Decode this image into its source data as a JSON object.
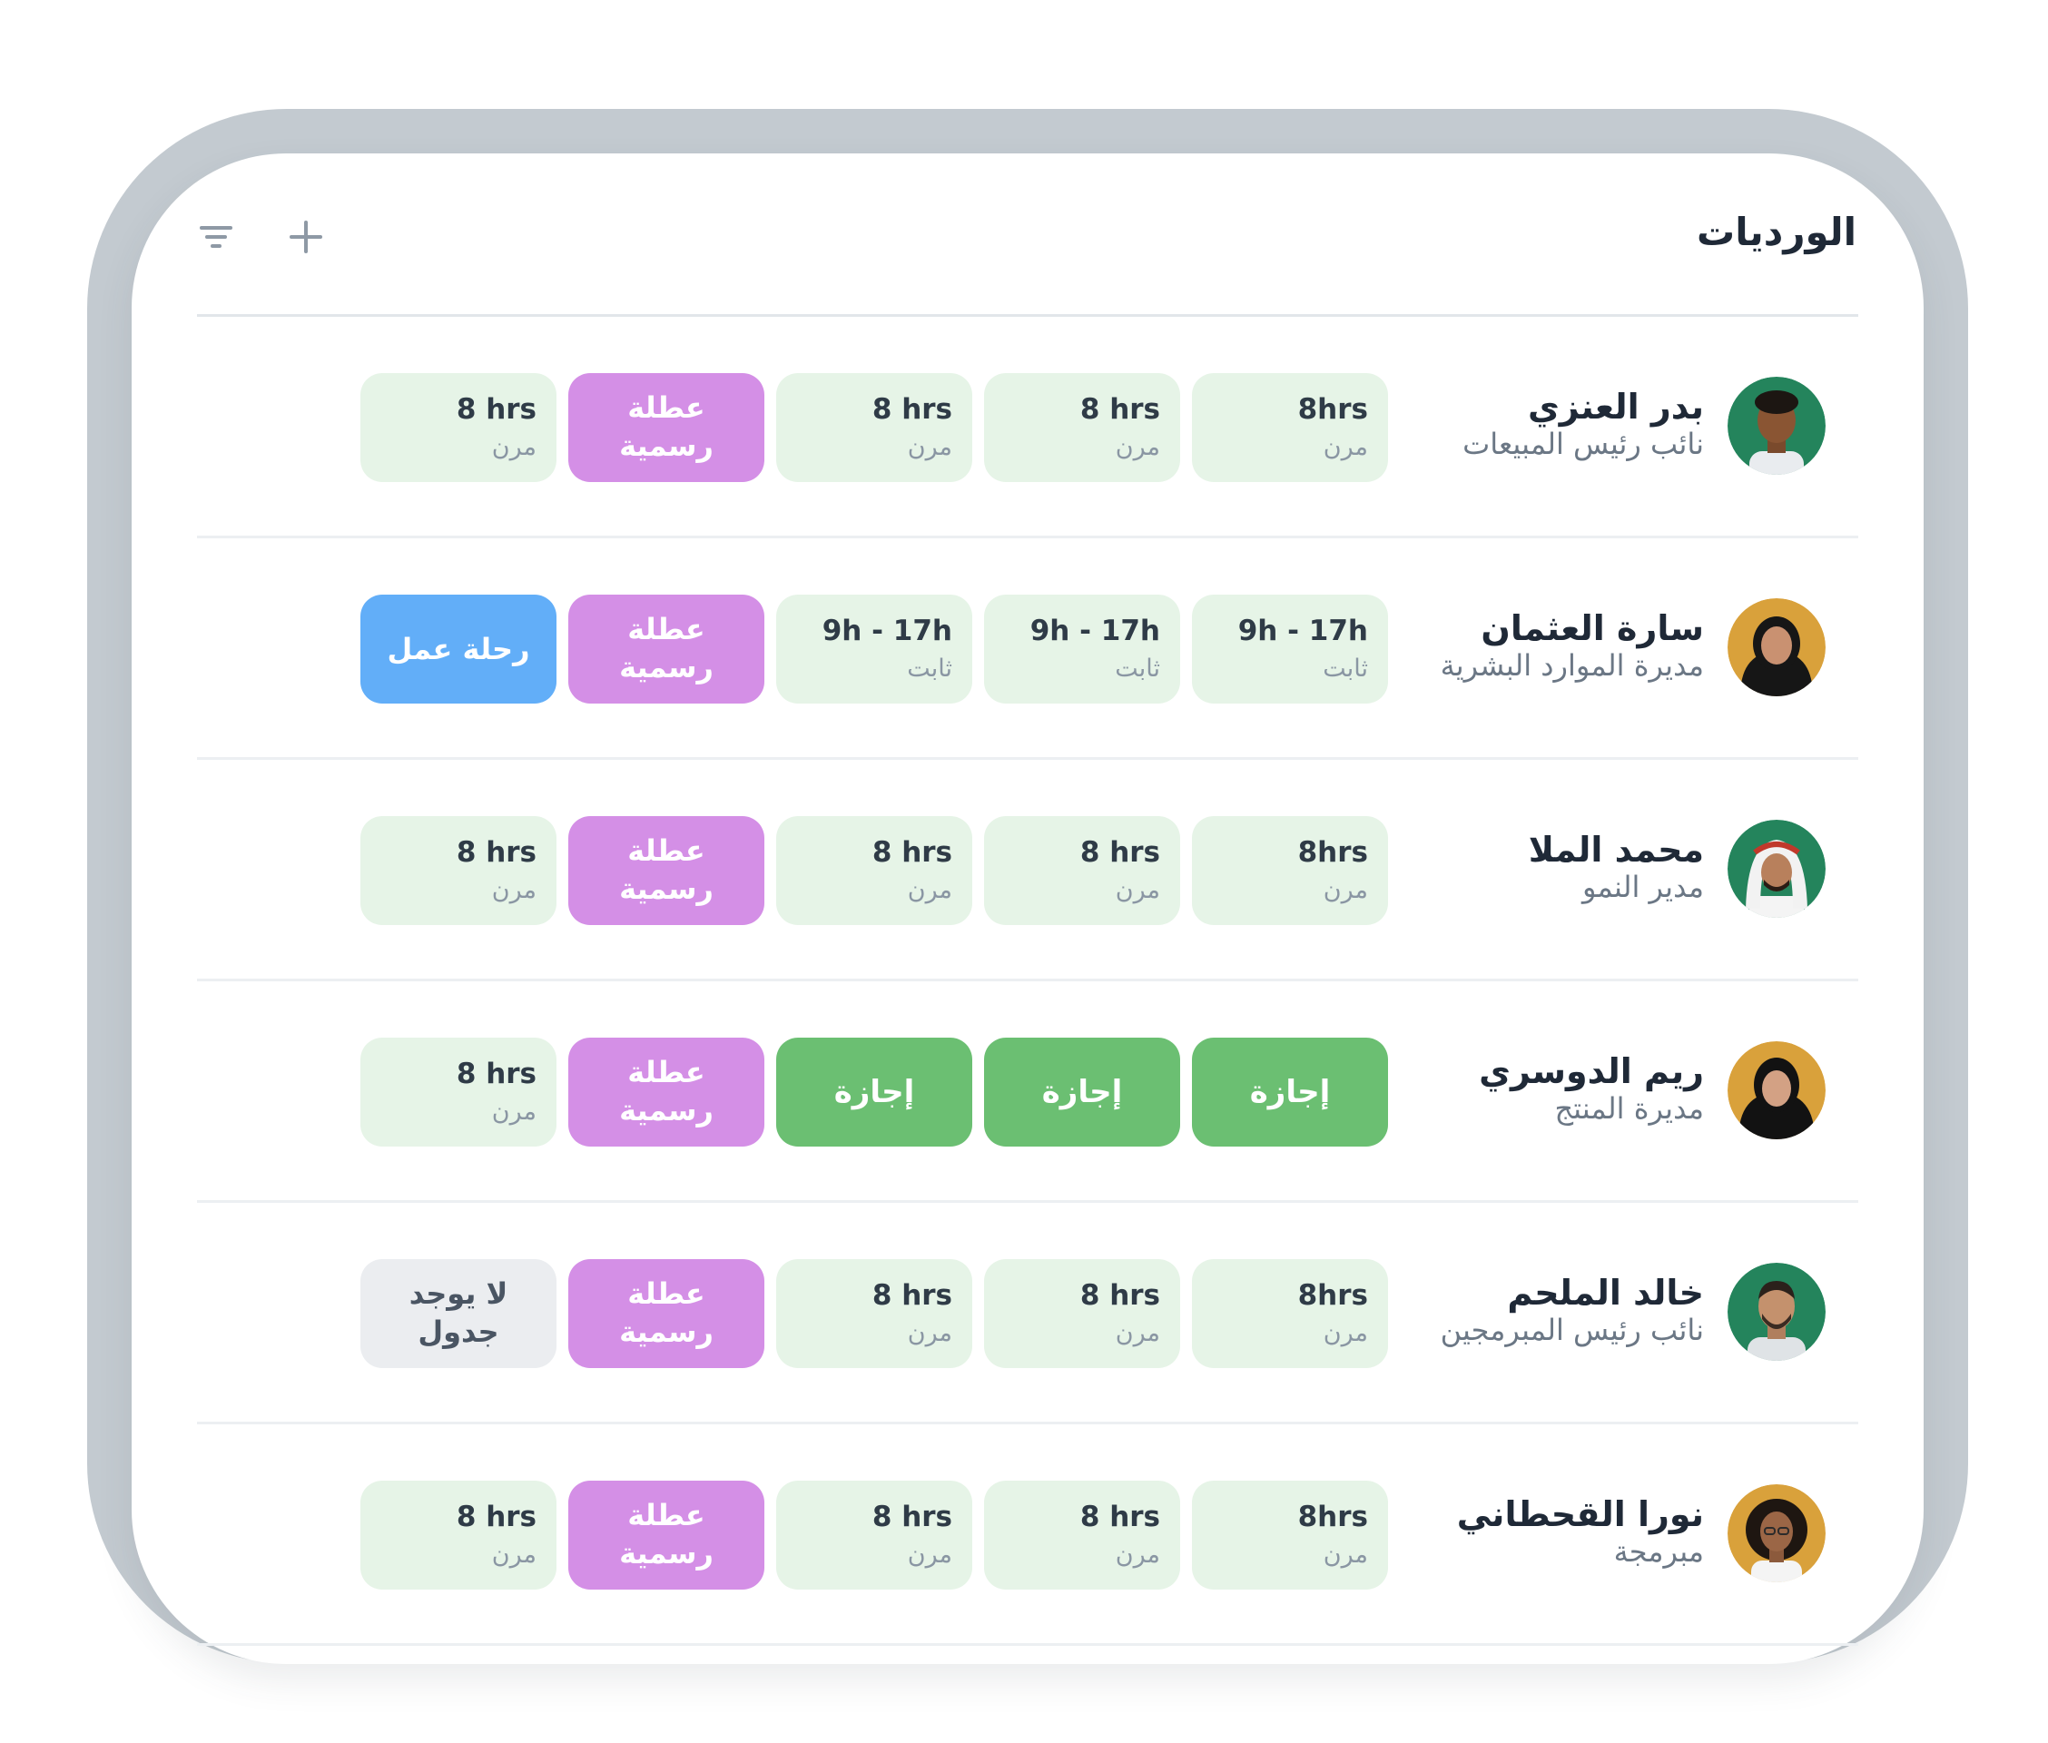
{
  "header": {
    "title": "الورديات",
    "filter_icon": "filter-icon",
    "add_icon": "plus-icon"
  },
  "colors": {
    "light_shift": "#e6f4e7",
    "holiday": "#d48fe6",
    "leave": "#6bbf72",
    "trip": "#62aef8",
    "no_schedule": "#ebedf0",
    "frame": "#c3cad0"
  },
  "employees": [
    {
      "name": "بدر العنزي",
      "role": "نائب رئيس المبيعات",
      "avatar_bg": "#24845c",
      "shifts": [
        {
          "top": "8hrs",
          "bottom": "مرن"
        },
        {
          "top": "8 hrs",
          "bottom": "مرن"
        },
        {
          "top": "8 hrs",
          "bottom": "مرن"
        },
        {
          "line1": "عطلة",
          "line2": "رسمية"
        },
        {
          "top": "8 hrs",
          "bottom": "مرن"
        }
      ]
    },
    {
      "name": "سارة العثمان",
      "role": "مديرة الموارد البشرية",
      "avatar_bg": "#d9a13b",
      "shifts": [
        {
          "top": "9h - 17h",
          "bottom": "ثابت"
        },
        {
          "top": "9h - 17h",
          "bottom": "ثابت"
        },
        {
          "top": "9h - 17h",
          "bottom": "ثابت"
        },
        {
          "line1": "عطلة",
          "line2": "رسمية"
        },
        {
          "label": "رحلة عمل"
        }
      ]
    },
    {
      "name": "محمد الملا",
      "role": "مدير النمو",
      "avatar_bg": "#24845c",
      "shifts": [
        {
          "top": "8hrs",
          "bottom": "مرن"
        },
        {
          "top": "8 hrs",
          "bottom": "مرن"
        },
        {
          "top": "8 hrs",
          "bottom": "مرن"
        },
        {
          "line1": "عطلة",
          "line2": "رسمية"
        },
        {
          "top": "8 hrs",
          "bottom": "مرن"
        }
      ]
    },
    {
      "name": "ريم الدوسري",
      "role": "مديرة المنتج",
      "avatar_bg": "#d9a13b",
      "shifts": [
        {
          "label": "إجازة"
        },
        {
          "label": "إجازة"
        },
        {
          "label": "إجازة"
        },
        {
          "line1": "عطلة",
          "line2": "رسمية"
        },
        {
          "top": "8 hrs",
          "bottom": "مرن"
        }
      ]
    },
    {
      "name": "خالد الملحم",
      "role": "نائب رئيس المبرمجين",
      "avatar_bg": "#24845c",
      "shifts": [
        {
          "top": "8hrs",
          "bottom": "مرن"
        },
        {
          "top": "8 hrs",
          "bottom": "مرن"
        },
        {
          "top": "8 hrs",
          "bottom": "مرن"
        },
        {
          "line1": "عطلة",
          "line2": "رسمية"
        },
        {
          "line1": "لا يوجد",
          "line2": "جدول"
        }
      ]
    },
    {
      "name": "نورا القحطاني",
      "role": "مبرمجة",
      "avatar_bg": "#d9a13b",
      "shifts": [
        {
          "top": "8hrs",
          "bottom": "مرن"
        },
        {
          "top": "8 hrs",
          "bottom": "مرن"
        },
        {
          "top": "8 hrs",
          "bottom": "مرن"
        },
        {
          "line1": "عطلة",
          "line2": "رسمية"
        },
        {
          "top": "8 hrs",
          "bottom": "مرن"
        }
      ]
    }
  ]
}
